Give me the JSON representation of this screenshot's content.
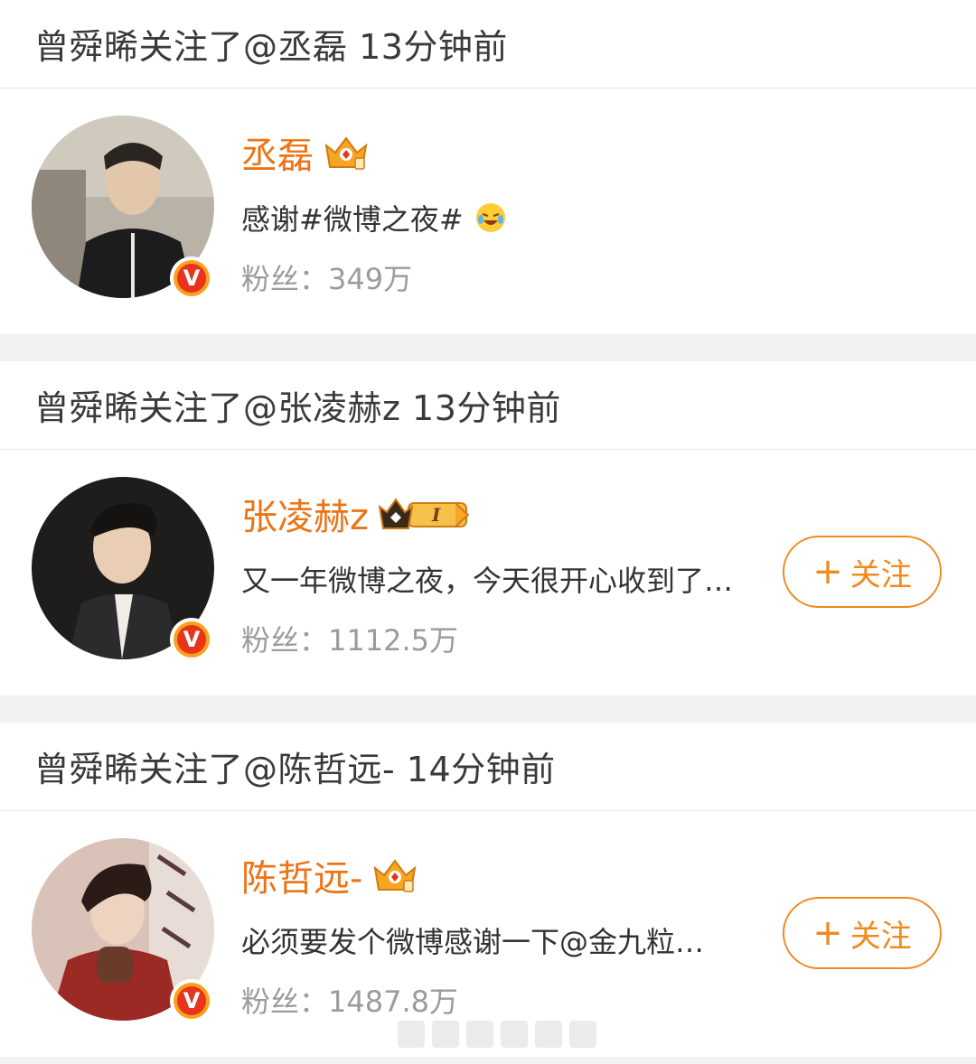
{
  "feed": [
    {
      "header": "曾舜晞关注了@丞磊 13分钟前",
      "name": "丞磊",
      "desc": "感谢#微博之夜#",
      "desc_emoji": "laugh-cry-emoji",
      "fans_label": "粉丝：",
      "fans_value": "349万",
      "badge": "crown-icon",
      "has_follow": false
    },
    {
      "header": "曾舜晞关注了@张凌赫z 13分钟前",
      "name": "张凌赫z",
      "desc": "又一年微博之夜，今天很开心收到了…",
      "fans_label": "粉丝：",
      "fans_value": "1112.5万",
      "badge": "crown-level-icon",
      "badge_level": "I",
      "has_follow": true,
      "follow_label": "关注"
    },
    {
      "header": "曾舜晞关注了@陈哲远- 14分钟前",
      "name": "陈哲远-",
      "desc": "必须要发个微博感谢一下@金九粒…",
      "fans_label": "粉丝：",
      "fans_value": "1487.8万",
      "badge": "crown-icon",
      "has_follow": true,
      "follow_label": "关注"
    }
  ],
  "verified_mark": "V",
  "follow_plus": "+",
  "colors": {
    "name": "#eb7417",
    "follow_border": "#f08a1f",
    "verified": "#e8341c",
    "background": "#f2f2f2"
  }
}
